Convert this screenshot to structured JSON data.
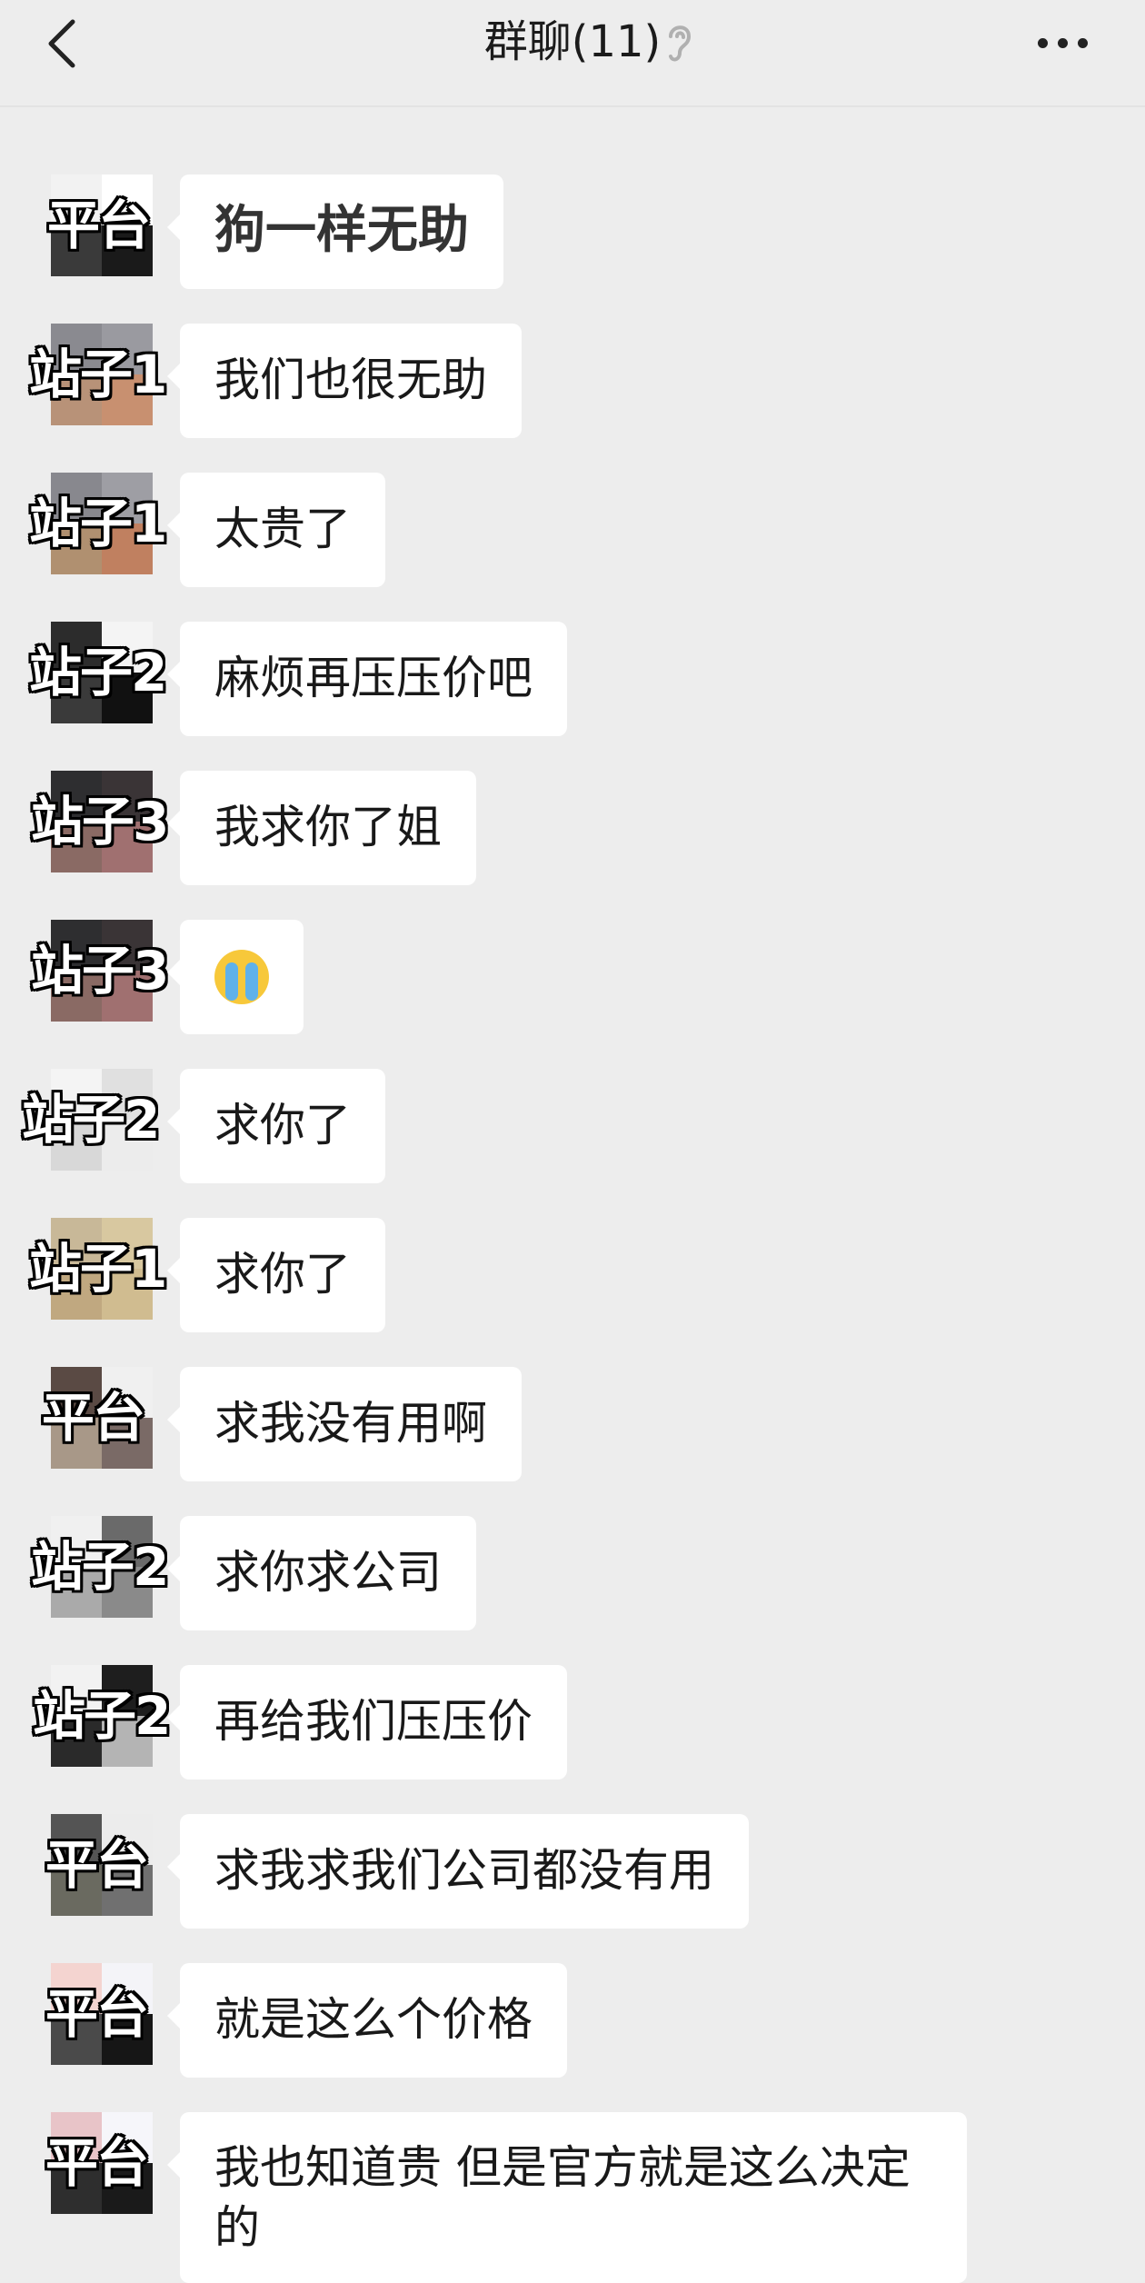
{
  "header": {
    "back_icon": "chevron-left-icon",
    "title": "群聊(11)",
    "ear_icon": "ear-icon",
    "more_icon": "more-horizontal-icon"
  },
  "messages": [
    {
      "sender": "平台",
      "text": "狗一样无助",
      "avatar_colors": [
        "#f2f2f2",
        "#ffffff",
        "#3a3a3a",
        "#1a1a1a"
      ]
    },
    {
      "sender": "站子1",
      "text": "我们也很无助",
      "avatar_colors": [
        "#8a8a90",
        "#9a9aa0",
        "#b89278",
        "#c89070"
      ]
    },
    {
      "sender": "站子1",
      "text": "太贵了",
      "avatar_colors": [
        "#88888e",
        "#9e9ea4",
        "#b09070",
        "#c08060"
      ]
    },
    {
      "sender": "站子2",
      "text": "麻烦再压压价吧",
      "avatar_colors": [
        "#2c2c2c",
        "#f4f4f4",
        "#3a3a3a",
        "#111111"
      ]
    },
    {
      "sender": "站子3",
      "text": "我求你了姐",
      "avatar_colors": [
        "#2e2e30",
        "#3a3436",
        "#8a6a64",
        "#a07070"
      ]
    },
    {
      "sender": "站子3",
      "text": "",
      "emoji": "crying-face-icon",
      "avatar_colors": [
        "#2e2e30",
        "#3a3436",
        "#8a6a64",
        "#a07070"
      ]
    },
    {
      "sender": "站子2",
      "text": "求你了",
      "avatar_colors": [
        "#f4f4f4",
        "#e0e0e0",
        "#d8d8d8",
        "#ececec"
      ]
    },
    {
      "sender": "站子1",
      "text": "求你了",
      "avatar_colors": [
        "#c8b898",
        "#d8c8a0",
        "#c0a880",
        "#d0bc90"
      ]
    },
    {
      "sender": "平台",
      "text": "求我没有用啊",
      "avatar_colors": [
        "#5a4a44",
        "#f0f0f0",
        "#a89888",
        "#7a6a66"
      ]
    },
    {
      "sender": "站子2",
      "text": "求你求公司",
      "avatar_colors": [
        "#f0f0f0",
        "#6a6a6a",
        "#aaaaaa",
        "#8a8a8a"
      ]
    },
    {
      "sender": "站子2",
      "text": "再给我们压压价",
      "avatar_colors": [
        "#f2f2f2",
        "#1e1e1e",
        "#2a2a2a",
        "#b4b4b4"
      ]
    },
    {
      "sender": "平台",
      "text": "求我求我们公司都没有用",
      "avatar_colors": [
        "#545454",
        "#ececec",
        "#6a6a60",
        "#707070"
      ]
    },
    {
      "sender": "平台",
      "text": "就是这么个价格",
      "avatar_colors": [
        "#f4d4d0",
        "#f4f4f8",
        "#4a4a4a",
        "#161616"
      ]
    },
    {
      "sender": "平台",
      "text": "我也知道贵 但是官方就是这么决定的",
      "avatar_colors": [
        "#e8c4c8",
        "#f6f6fa",
        "#2e2e2e",
        "#1a1a1a"
      ]
    }
  ]
}
